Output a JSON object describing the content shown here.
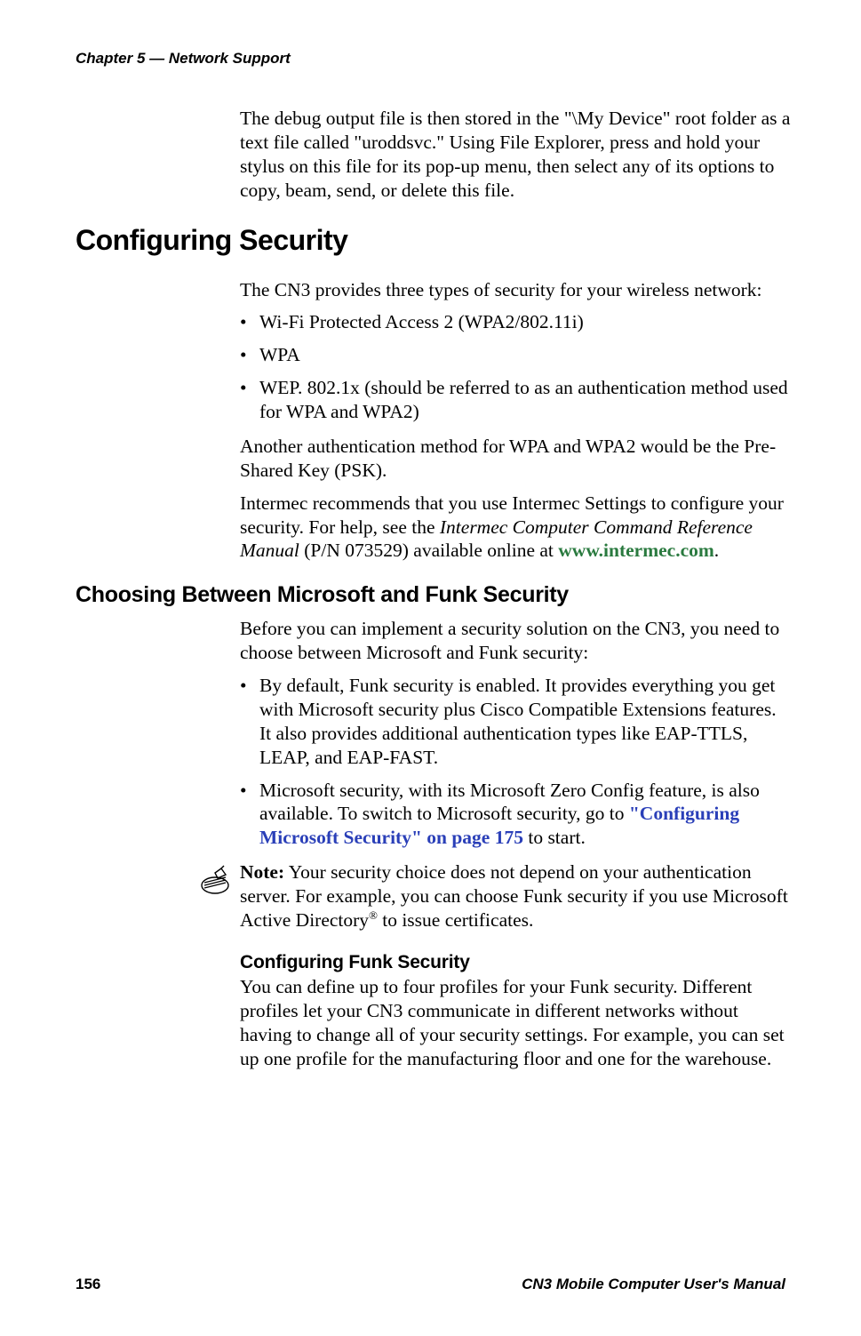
{
  "running_head": "Chapter 5 — Network Support",
  "intro_para": "The debug output file is then stored in the \"\\My Device\" root folder as a text file called \"uroddsvc.\" Using File Explorer, press and hold your stylus on this file for its pop-up menu, then select any of its options to copy, beam, send, or delete this file.",
  "h1": "Configuring Security",
  "sec1_para": "The CN3 provides three types of security for your wireless network:",
  "sec1_bullets": {
    "b1": "Wi-Fi Protected Access 2 (WPA2/802.11i)",
    "b2": "WPA",
    "b3": "WEP. 802.1x (should be referred to as an authentication method used for WPA and WPA2)"
  },
  "sec1_para2": "Another authentication method for WPA and WPA2 would be the Pre-Shared Key (PSK).",
  "sec1_para3_pre": "Intermec recommends that you use Intermec Settings to configure your security. For help, see the ",
  "sec1_para3_ital": "Intermec Computer Command Reference Manual",
  "sec1_para3_mid": " (P/N 073529) available online at ",
  "sec1_para3_link": "www.intermec.com",
  "sec1_para3_post": ".",
  "h2": "Choosing Between Microsoft and Funk Security",
  "sec2_para": "Before you can implement a security solution on the CN3, you need to choose between Microsoft and Funk security:",
  "sec2_bullets": {
    "b1": "By default, Funk security is enabled. It provides everything you get with Microsoft security plus Cisco Compatible Extensions features. It also provides additional authentication types like EAP-TTLS, LEAP, and EAP-FAST.",
    "b2_pre": "Microsoft security, with its Microsoft Zero Config feature, is also available. To switch to Microsoft security, go to ",
    "b2_link": "\"Configuring Microsoft Security\" on page 175",
    "b2_post": " to start."
  },
  "note": {
    "label": "Note:",
    "text_pre": " Your security choice does not depend on your authentication server. For example, you can choose Funk security if you use Microsoft Active Directory",
    "reg": "®",
    "text_post": " to issue certificates."
  },
  "h3": "Configuring Funk Security",
  "sec3_para": "You can define up to four profiles for your Funk security. Different profiles let your CN3 communicate in different networks without having to change all of your security settings. For example, you can set up one profile for the manufacturing floor and one for the warehouse.",
  "footer": {
    "page": "156",
    "title": "CN3 Mobile Computer User's Manual"
  }
}
